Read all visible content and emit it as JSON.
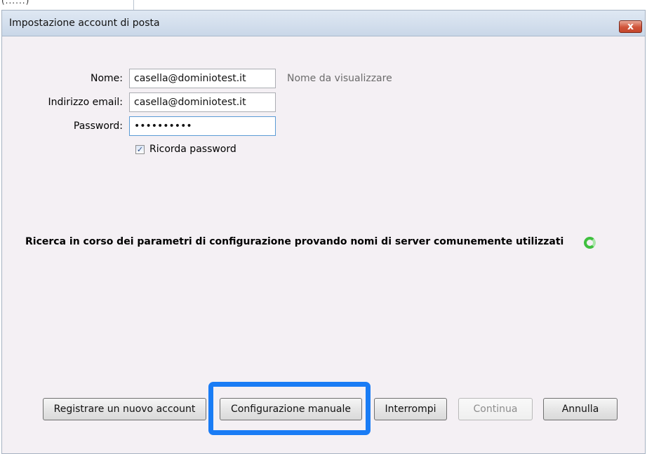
{
  "background": {
    "fragment_text": "(......)"
  },
  "window": {
    "title": "Impostazione account di posta",
    "close_label": "x"
  },
  "form": {
    "name_label": "Nome:",
    "name_value": "casella@dominiotest.it",
    "name_hint": "Nome da visualizzare",
    "email_label": "Indirizzo email:",
    "email_value": "casella@dominiotest.it",
    "password_label": "Password:",
    "password_value": "••••••••••",
    "remember_label": "Ricorda password",
    "remember_checked": true
  },
  "status": {
    "message": "Ricerca in corso dei parametri di configurazione provando nomi di server comunemente utilizzati"
  },
  "buttons": {
    "register": "Registrare un nuovo account",
    "manual": "Configurazione manuale",
    "stop": "Interrompi",
    "continue": "Continua",
    "cancel": "Annulla"
  },
  "colors": {
    "highlight": "#1a7cf5",
    "spinner": "#3fc03f",
    "close": "#d0543a"
  }
}
